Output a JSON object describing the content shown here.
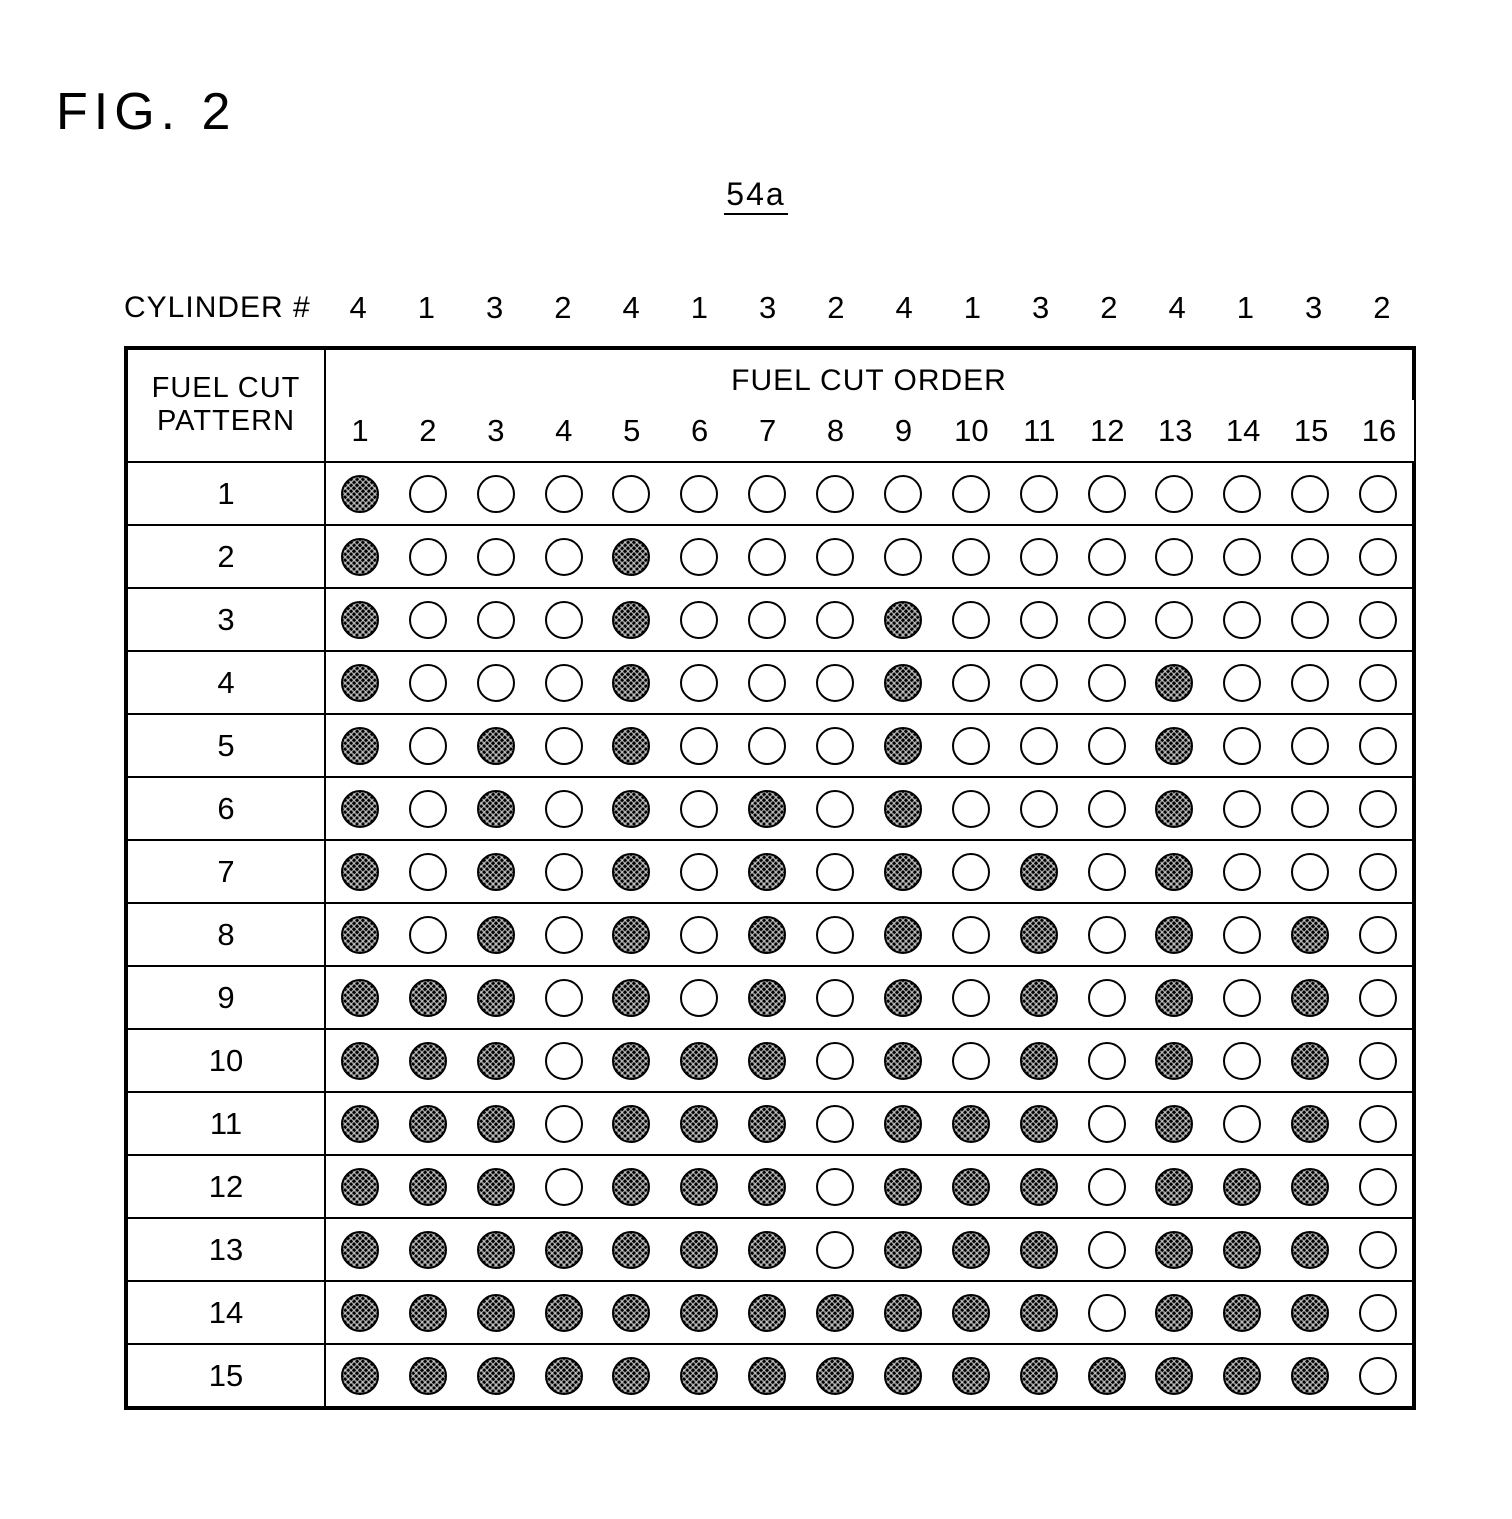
{
  "figure": {
    "title": "FIG. 2",
    "reference_label": "54a"
  },
  "cylinder_header": {
    "caption": "CYLINDER #",
    "values": [
      "4",
      "1",
      "3",
      "2",
      "4",
      "1",
      "3",
      "2",
      "4",
      "1",
      "3",
      "2",
      "4",
      "1",
      "3",
      "2"
    ]
  },
  "table": {
    "corner_label_line1": "FUEL CUT",
    "corner_label_line2": "PATTERN",
    "order_title": "FUEL CUT ORDER",
    "order_numbers": [
      "1",
      "2",
      "3",
      "4",
      "5",
      "6",
      "7",
      "8",
      "9",
      "10",
      "11",
      "12",
      "13",
      "14",
      "15",
      "16"
    ],
    "rows": [
      {
        "pattern": "1",
        "cells": [
          1,
          0,
          0,
          0,
          0,
          0,
          0,
          0,
          0,
          0,
          0,
          0,
          0,
          0,
          0,
          0
        ]
      },
      {
        "pattern": "2",
        "cells": [
          1,
          0,
          0,
          0,
          1,
          0,
          0,
          0,
          0,
          0,
          0,
          0,
          0,
          0,
          0,
          0
        ]
      },
      {
        "pattern": "3",
        "cells": [
          1,
          0,
          0,
          0,
          1,
          0,
          0,
          0,
          1,
          0,
          0,
          0,
          0,
          0,
          0,
          0
        ]
      },
      {
        "pattern": "4",
        "cells": [
          1,
          0,
          0,
          0,
          1,
          0,
          0,
          0,
          1,
          0,
          0,
          0,
          1,
          0,
          0,
          0
        ]
      },
      {
        "pattern": "5",
        "cells": [
          1,
          0,
          1,
          0,
          1,
          0,
          0,
          0,
          1,
          0,
          0,
          0,
          1,
          0,
          0,
          0
        ]
      },
      {
        "pattern": "6",
        "cells": [
          1,
          0,
          1,
          0,
          1,
          0,
          1,
          0,
          1,
          0,
          0,
          0,
          1,
          0,
          0,
          0
        ]
      },
      {
        "pattern": "7",
        "cells": [
          1,
          0,
          1,
          0,
          1,
          0,
          1,
          0,
          1,
          0,
          1,
          0,
          1,
          0,
          0,
          0
        ]
      },
      {
        "pattern": "8",
        "cells": [
          1,
          0,
          1,
          0,
          1,
          0,
          1,
          0,
          1,
          0,
          1,
          0,
          1,
          0,
          1,
          0
        ]
      },
      {
        "pattern": "9",
        "cells": [
          1,
          1,
          1,
          0,
          1,
          0,
          1,
          0,
          1,
          0,
          1,
          0,
          1,
          0,
          1,
          0
        ]
      },
      {
        "pattern": "10",
        "cells": [
          1,
          1,
          1,
          0,
          1,
          1,
          1,
          0,
          1,
          0,
          1,
          0,
          1,
          0,
          1,
          0
        ]
      },
      {
        "pattern": "11",
        "cells": [
          1,
          1,
          1,
          0,
          1,
          1,
          1,
          0,
          1,
          1,
          1,
          0,
          1,
          0,
          1,
          0
        ]
      },
      {
        "pattern": "12",
        "cells": [
          1,
          1,
          1,
          0,
          1,
          1,
          1,
          0,
          1,
          1,
          1,
          0,
          1,
          1,
          1,
          0
        ]
      },
      {
        "pattern": "13",
        "cells": [
          1,
          1,
          1,
          1,
          1,
          1,
          1,
          0,
          1,
          1,
          1,
          0,
          1,
          1,
          1,
          0
        ]
      },
      {
        "pattern": "14",
        "cells": [
          1,
          1,
          1,
          1,
          1,
          1,
          1,
          1,
          1,
          1,
          1,
          0,
          1,
          1,
          1,
          0
        ]
      },
      {
        "pattern": "15",
        "cells": [
          1,
          1,
          1,
          1,
          1,
          1,
          1,
          1,
          1,
          1,
          1,
          1,
          1,
          1,
          1,
          0
        ]
      }
    ]
  },
  "legend": {
    "filled_meaning": "fuel cut (hatched/filled circle)",
    "open_meaning": "no fuel cut (open circle)"
  },
  "colors": {
    "ink": "#000000",
    "paper": "#ffffff"
  }
}
